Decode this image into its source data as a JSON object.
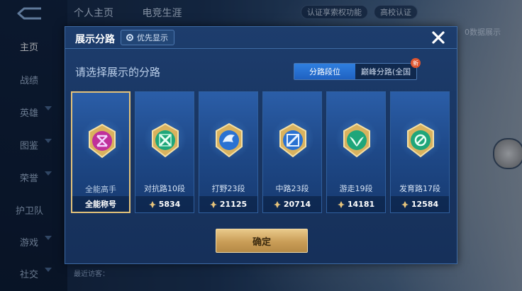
{
  "background": {
    "top_tabs": [
      "个人主页",
      "电竞生涯"
    ],
    "top_right": {
      "text": "认证享索权功能",
      "badge": "高校认证",
      "hint": "0数据展示"
    },
    "left_nav": [
      {
        "label": "主页",
        "active": true
      },
      {
        "label": "战绩"
      },
      {
        "label": "英雄"
      },
      {
        "label": "图鉴"
      },
      {
        "label": "荣誉"
      },
      {
        "label": "护卫队"
      },
      {
        "label": "游戏"
      },
      {
        "label": "社交"
      }
    ],
    "bottom_text": "最近访客："
  },
  "modal": {
    "title": "展示分路",
    "priority_label": "优先显示",
    "subtitle": "请选择展示的分路",
    "segments": [
      {
        "label": "分路段位",
        "active": true
      },
      {
        "label": "巅峰分路(全国",
        "badge": "新"
      }
    ],
    "cards": [
      {
        "label": "全能高手",
        "foot": "全能称号",
        "selected": true,
        "color": "#c0309a"
      },
      {
        "label": "对抗路10段",
        "points": "5834",
        "color": "#1fa67a"
      },
      {
        "label": "打野23段",
        "points": "21125",
        "color": "#2a72d2"
      },
      {
        "label": "中路23段",
        "points": "20714",
        "color": "#2a72d2"
      },
      {
        "label": "游走19段",
        "points": "14181",
        "color": "#1fa67a"
      },
      {
        "label": "发育路17段",
        "points": "12584",
        "color": "#1fa67a"
      }
    ],
    "confirm_label": "确定"
  }
}
